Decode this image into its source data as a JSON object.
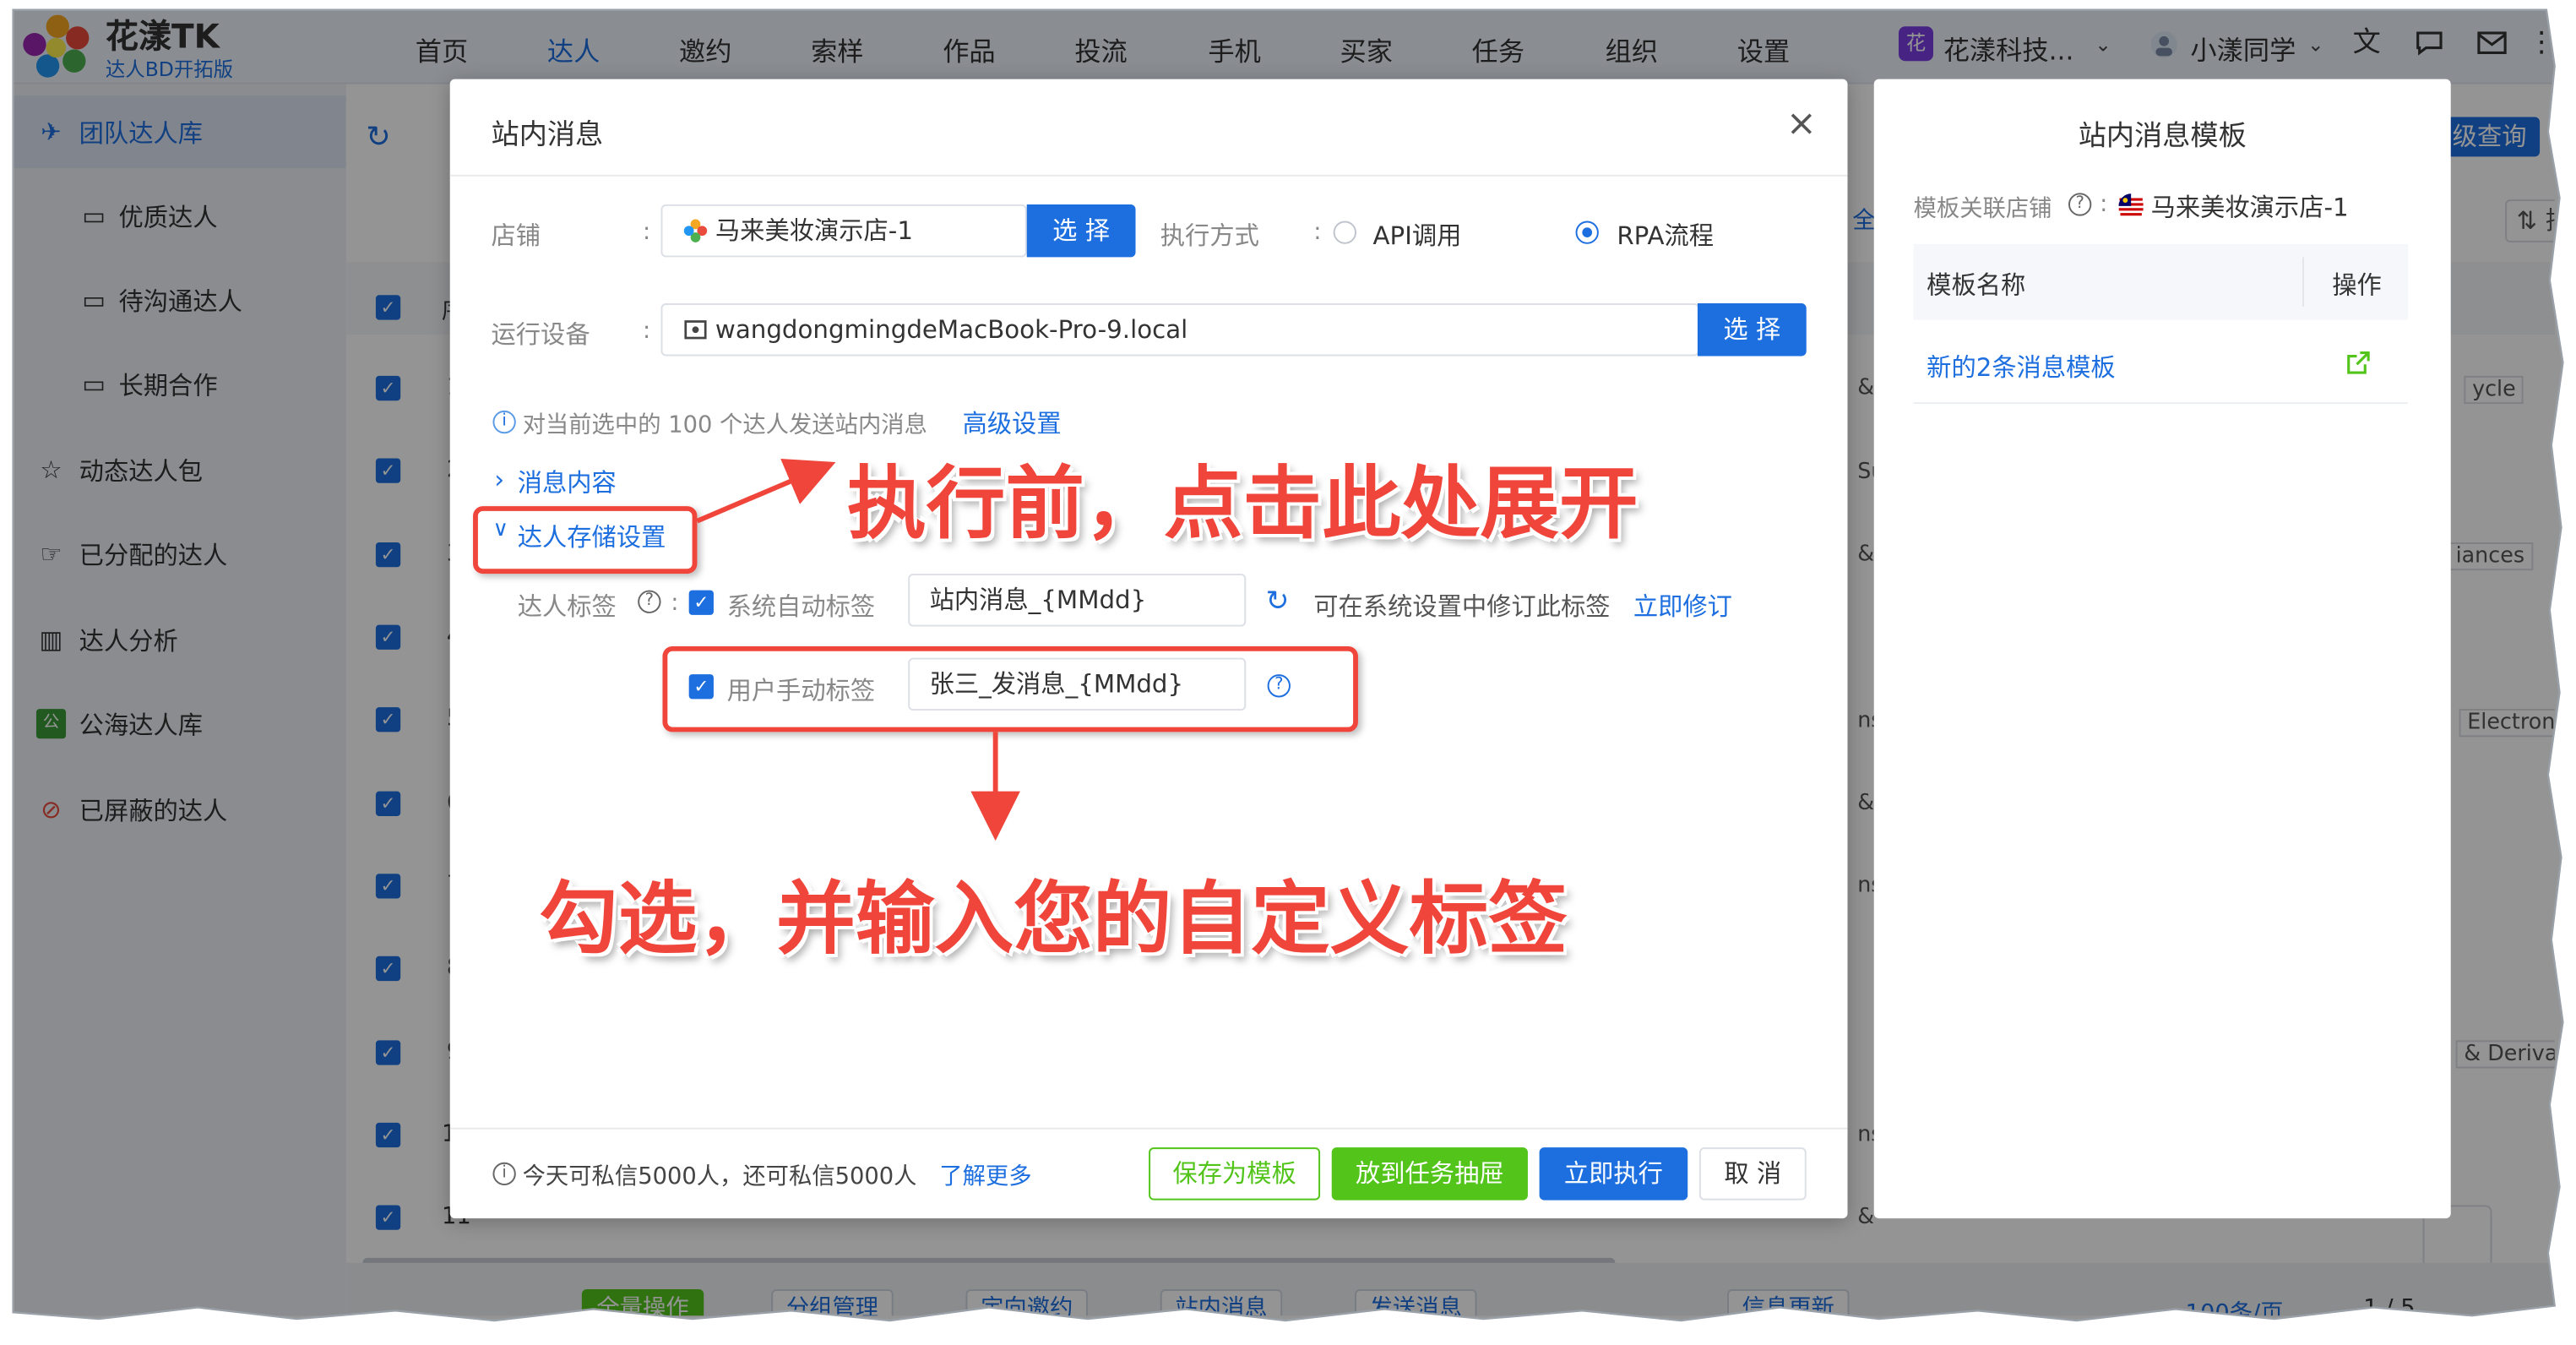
{
  "brand": {
    "title": "花漾TK",
    "subtitle": "达人BD开拓版"
  },
  "nav": [
    "首页",
    "达人",
    "邀约",
    "索样",
    "作品",
    "投流",
    "手机",
    "买家",
    "任务",
    "组织",
    "设置"
  ],
  "top_right": {
    "org_badge": "花",
    "org_name": "花漾科技...",
    "user": "小漾同学"
  },
  "sidebar": [
    {
      "label": "团队达人库",
      "icon": "team-icon"
    },
    {
      "label": "优质达人",
      "icon": "folder-icon"
    },
    {
      "label": "待沟通达人",
      "icon": "folder-icon"
    },
    {
      "label": "长期合作",
      "icon": "folder-icon"
    },
    {
      "label": "动态达人包",
      "icon": "star-icon"
    },
    {
      "label": "已分配的达人",
      "icon": "assign-icon"
    },
    {
      "label": "达人分析",
      "icon": "chart-icon"
    },
    {
      "label": "公海达人库",
      "icon": "public-icon"
    },
    {
      "label": "已屏蔽的达人",
      "icon": "block-icon"
    }
  ],
  "background": {
    "col_header": "序",
    "row_numbers": [
      "1",
      "2",
      "3",
      "4",
      "5",
      "6",
      "7",
      "8",
      "9",
      "10",
      "11"
    ],
    "advanced_query": "级查询",
    "sort": "排序",
    "tab_fragment": "全部",
    "cell_fragments": [
      "ycle",
      "iances",
      "Electron",
      "& Derivativ",
      "& ",
      "Sup",
      "& ",
      "nsw",
      "& ",
      "nsw",
      "nsw",
      "& "
    ],
    "bottom_buttons": [
      "全量操作",
      "分组管理",
      "定向邀约",
      "站内消息",
      "发送消息",
      "信息更新"
    ],
    "page_size": "100条/页",
    "pager": "1 / 5"
  },
  "dialog": {
    "title": "站内消息",
    "store_label": "店铺",
    "store_value": "马来美妆演示店-1",
    "select_label": "选 择",
    "exec_label": "执行方式",
    "exec_options": [
      "API调用",
      "RPA流程"
    ],
    "exec_selected": "RPA流程",
    "device_label": "运行设备",
    "device_value": "wangdongmingdeMacBook-Pro-9.local",
    "info_text": "对当前选中的 100 个达人发送站内消息",
    "advanced_link": "高级设置",
    "msg_content": "消息内容",
    "storage_settings": "达人存储设置",
    "tag_label": "达人标签",
    "auto_tag_label": "系统自动标签",
    "auto_tag_value": "站内消息_{MMdd}",
    "auto_tag_hint": "可在系统设置中修订此标签",
    "auto_tag_link": "立即修订",
    "manual_tag_label": "用户手动标签",
    "manual_tag_value": "张三_发消息_{MMdd}",
    "footer_info": "今天可私信5000人，还可私信5000人",
    "footer_link": "了解更多",
    "btn_save_template": "保存为模板",
    "btn_to_drawer": "放到任务抽屉",
    "btn_execute": "立即执行",
    "btn_cancel": "取 消"
  },
  "panel": {
    "title": "站内消息模板",
    "store_label": "模板关联店铺",
    "store_value": "马来美妆演示店-1",
    "col_name": "模板名称",
    "col_op": "操作",
    "rows": [
      {
        "name": "新的2条消息模板"
      }
    ]
  },
  "annotations": {
    "expand_hint": "执行前，点击此处展开",
    "tag_hint": "勾选，并输入您的自定义标签"
  },
  "colors": {
    "primary": "#1d6fe0",
    "success": "#52c41a",
    "annotation": "#f0453b"
  }
}
